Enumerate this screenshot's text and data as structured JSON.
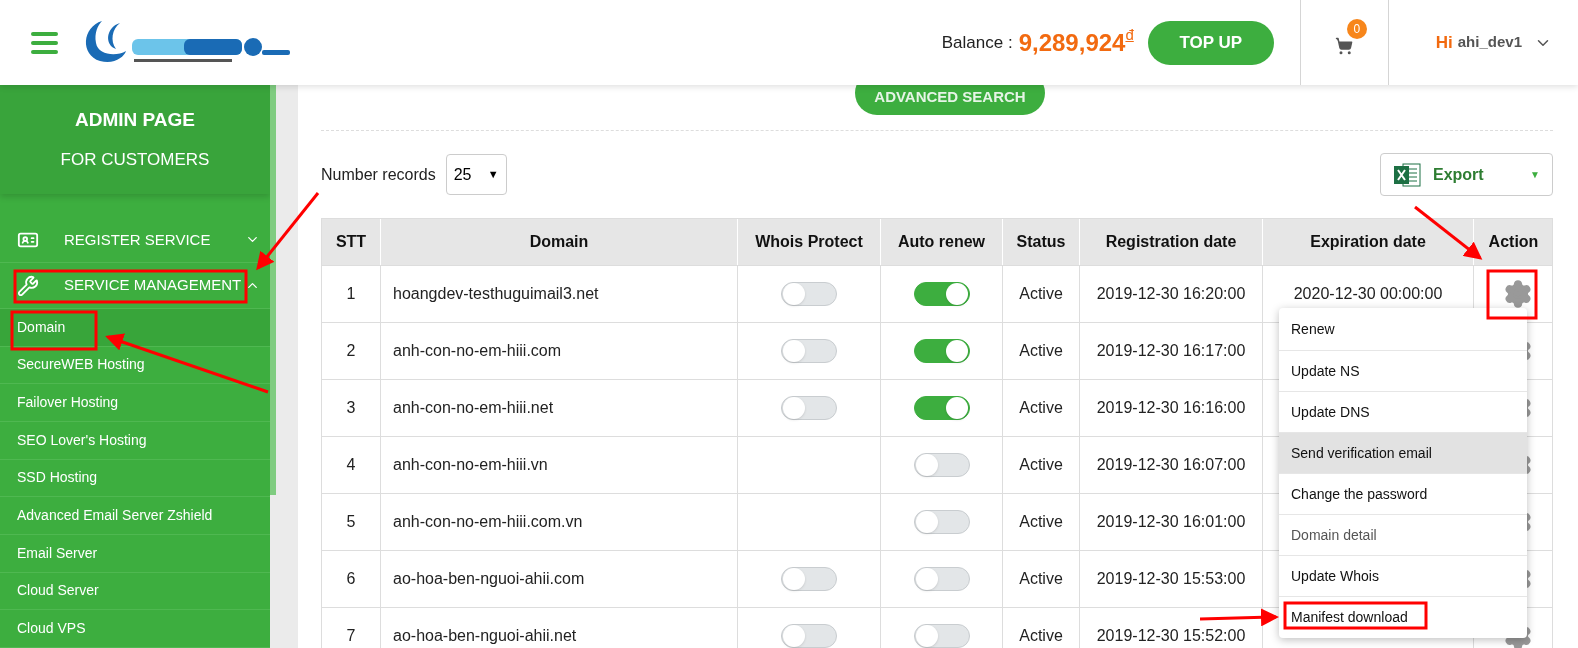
{
  "header": {
    "balance_label": "Balance :",
    "balance_value": "9,289,924",
    "currency": "đ",
    "topup_button": "TOP UP",
    "cart_count": "0",
    "greeting": "Hi",
    "username": "ahi_dev1"
  },
  "sidebar": {
    "title": "ADMIN PAGE",
    "subtitle": "FOR CUSTOMERS",
    "sections": [
      {
        "label": "REGISTER SERVICE",
        "expanded": false
      },
      {
        "label": "SERVICE MANAGEMENT",
        "expanded": true,
        "children": [
          {
            "label": "Domain",
            "selected": true
          },
          {
            "label": "SecureWEB Hosting",
            "selected": false
          },
          {
            "label": "Failover Hosting",
            "selected": false
          },
          {
            "label": "SEO Lover's Hosting",
            "selected": false
          },
          {
            "label": "SSD Hosting",
            "selected": false
          },
          {
            "label": "Advanced Email Server Zshield",
            "selected": false
          },
          {
            "label": "Email Server",
            "selected": false
          },
          {
            "label": "Cloud Server",
            "selected": false
          },
          {
            "label": "Cloud VPS",
            "selected": false
          }
        ]
      }
    ]
  },
  "toolbar": {
    "advanced_search": "ADVANCED SEARCH",
    "records_label": "Number records",
    "records_value": "25",
    "records_caret": "▼",
    "export_button": "Export",
    "export_caret": "▼"
  },
  "table": {
    "columns": [
      "STT",
      "Domain",
      "Whois Protect",
      "Auto renew",
      "Status",
      "Registration date",
      "Expiration date",
      "Action"
    ],
    "rows": [
      {
        "stt": "1",
        "domain": "hoangdev-testhuguimail3.net",
        "whois": {
          "on": false
        },
        "auto_renew": {
          "on": true
        },
        "status": "Active",
        "registered": "2019-12-30 16:20:00",
        "expires": "2020-12-30 00:00:00"
      },
      {
        "stt": "2",
        "domain": "anh-con-no-em-hiii.com",
        "whois": {
          "on": false
        },
        "auto_renew": {
          "on": true
        },
        "status": "Active",
        "registered": "2019-12-30 16:17:00"
      },
      {
        "stt": "3",
        "domain": "anh-con-no-em-hiii.net",
        "whois": {
          "on": false
        },
        "auto_renew": {
          "on": true
        },
        "status": "Active",
        "registered": "2019-12-30 16:16:00"
      },
      {
        "stt": "4",
        "domain": "anh-con-no-em-hiii.vn",
        "auto_renew": {
          "on": false
        },
        "status": "Active",
        "registered": "2019-12-30 16:07:00"
      },
      {
        "stt": "5",
        "domain": "anh-con-no-em-hiii.com.vn",
        "auto_renew": {
          "on": false
        },
        "status": "Active",
        "registered": "2019-12-30 16:01:00"
      },
      {
        "stt": "6",
        "domain": "ao-hoa-ben-nguoi-ahii.com",
        "whois": {
          "on": false
        },
        "auto_renew": {
          "on": false
        },
        "status": "Active",
        "registered": "2019-12-30 15:53:00"
      },
      {
        "stt": "7",
        "domain": "ao-hoa-ben-nguoi-ahii.net",
        "whois": {
          "on": false
        },
        "auto_renew": {
          "on": false
        },
        "status": "Active",
        "registered": "2019-12-30 15:52:00"
      }
    ]
  },
  "action_menu": {
    "items": [
      {
        "label": "Renew",
        "highlighted": false,
        "disabled": false
      },
      {
        "label": "Update NS",
        "highlighted": false,
        "disabled": false
      },
      {
        "label": "Update DNS",
        "highlighted": false,
        "disabled": false
      },
      {
        "label": "Send verification email",
        "highlighted": true,
        "disabled": false
      },
      {
        "label": "Change the password",
        "highlighted": false,
        "disabled": false
      },
      {
        "label": "Domain detail",
        "highlighted": false,
        "disabled": true
      },
      {
        "label": "Update Whois",
        "highlighted": false,
        "disabled": false
      },
      {
        "label": "Manifest download",
        "highlighted": false,
        "disabled": false
      }
    ]
  }
}
